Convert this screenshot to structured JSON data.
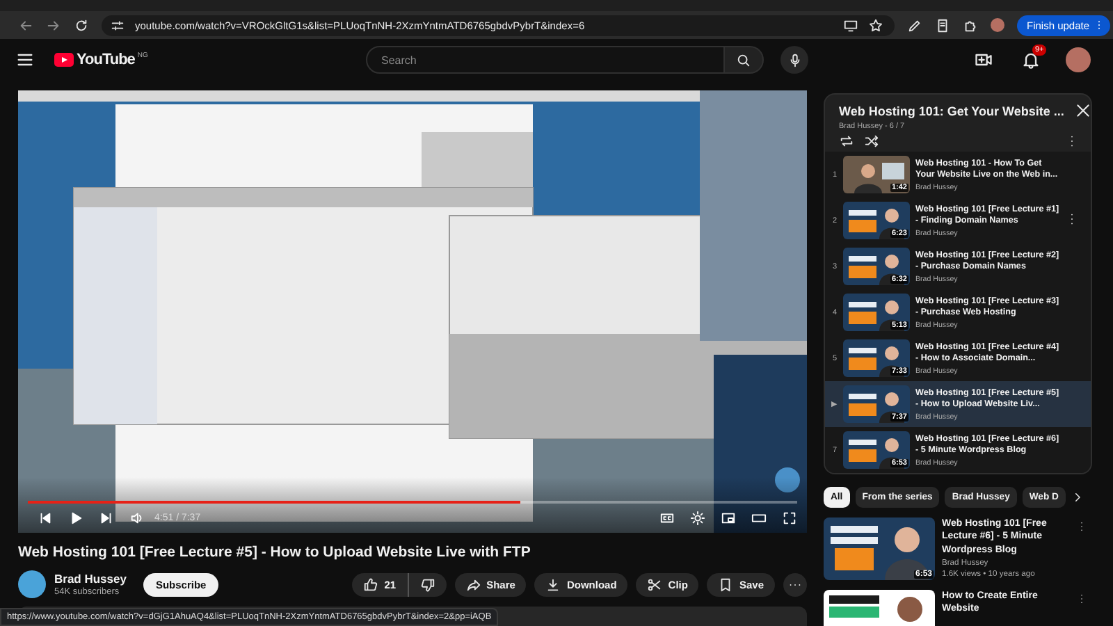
{
  "browser": {
    "url": "youtube.com/watch?v=VROckGltG1s&list=PLUoqTnNH-2XzmYntmATD6765gbdvPybrT&index=6",
    "update_button": "Finish update"
  },
  "header": {
    "logo": "YouTube",
    "region": "NG",
    "search": {
      "placeholder": "Search"
    },
    "notifications": "9+"
  },
  "player": {
    "kind": "picture",
    "time": "4:51 / 7:37",
    "level": 0.64
  },
  "video": {
    "title": "Web Hosting 101 [Free Lecture #5] - How to Upload Website Live with FTP",
    "channel": "Brad Hussey",
    "subscribers": "54K subscribers",
    "subscribe": "Subscribe",
    "likes": "21",
    "actions": [
      "Share",
      "Download",
      "Clip",
      "Save"
    ]
  },
  "playlist": {
    "title": "Web Hosting 101: Get Your Website ...",
    "meta": "Brad Hussey - 6 / 7",
    "items": [
      {
        "index": "1",
        "title": "Web Hosting 101 - How To Get Your Website Live on the Web in...",
        "channel": "Brad Hussey",
        "duration": "1:42",
        "selected": false
      },
      {
        "index": "2",
        "title": "Web Hosting 101 [Free Lecture #1] - Finding Domain Names",
        "channel": "Brad Hussey",
        "duration": "6:23",
        "selected": false
      },
      {
        "index": "3",
        "title": "Web Hosting 101 [Free Lecture #2] - Purchase Domain Names",
        "channel": "Brad Hussey",
        "duration": "6:32",
        "selected": false
      },
      {
        "index": "4",
        "title": "Web Hosting 101 [Free Lecture #3] - Purchase Web Hosting",
        "channel": "Brad Hussey",
        "duration": "5:13",
        "selected": false
      },
      {
        "index": "5",
        "title": "Web Hosting 101 [Free Lecture #4] - How to Associate Domain...",
        "channel": "Brad Hussey",
        "duration": "7:33",
        "selected": false
      },
      {
        "index": "▶",
        "title": "Web Hosting 101 [Free Lecture #5] - How to Upload Website Liv...",
        "channel": "Brad Hussey",
        "duration": "7:37",
        "selected": true
      },
      {
        "index": "7",
        "title": "Web Hosting 101 [Free Lecture #6] - 5 Minute Wordpress Blog",
        "channel": "Brad Hussey",
        "duration": "6:53",
        "selected": false
      }
    ]
  },
  "chips": [
    {
      "label": "All",
      "selected": true
    },
    {
      "label": "From the series",
      "selected": false
    },
    {
      "label": "Brad Hussey",
      "selected": false
    },
    {
      "label": "Web D",
      "selected": false
    }
  ],
  "recommended": [
    {
      "title": "Web Hosting 101 [Free Lecture #6] - 5 Minute Wordpress Blog",
      "channel": "Brad Hussey",
      "meta": "1.6K views • 10 years ago",
      "duration": "6:53"
    },
    {
      "title": "How to Create Entire Website"
    }
  ],
  "status_bar": {
    "url": "https://www.youtube.com/watch?v=dGjG1AhuAQ4&list=PLUoqTnNH-2XzmYntmATD6765gbdvPybrT&index=2&pp=iAQB"
  }
}
